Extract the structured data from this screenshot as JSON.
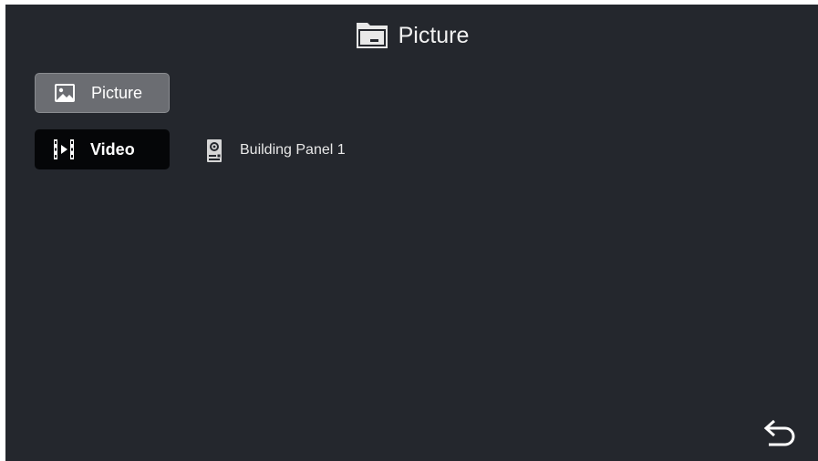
{
  "header": {
    "title": "Picture",
    "icon": "folder-icon"
  },
  "nav": {
    "items": [
      {
        "label": "Picture",
        "icon": "image-icon",
        "selected": true
      },
      {
        "label": "Video",
        "icon": "film-icon",
        "selected": false
      }
    ]
  },
  "list": {
    "items": [
      {
        "label": "Building Panel 1",
        "icon": "door-panel-icon"
      }
    ]
  },
  "footer": {
    "back_icon": "back-arrow-icon"
  },
  "colors": {
    "background": "#24272d",
    "selected_button": "#6b6d72",
    "button": "#050608",
    "text": "#ffffff"
  }
}
